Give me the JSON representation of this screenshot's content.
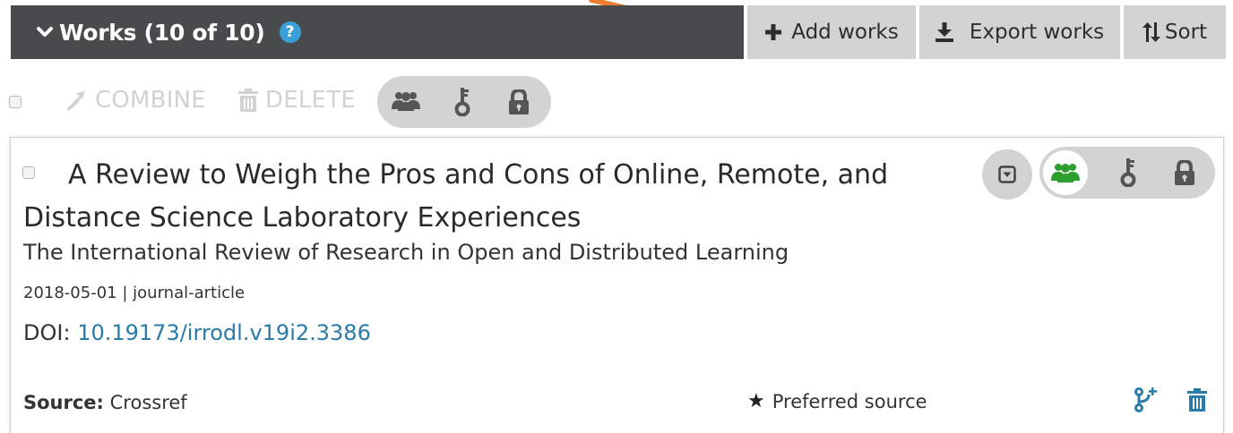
{
  "header": {
    "title": "Works (10 of 10)",
    "help_label": "?",
    "add_works_label": "Add works",
    "export_works_label": "Export works",
    "sort_label": "Sort"
  },
  "bulk_toolbar": {
    "combine_label": "COMBINE",
    "delete_label": "DELETE",
    "visibility_options": [
      "everyone-icon",
      "trusted-parties-icon",
      "only-me-icon"
    ]
  },
  "work": {
    "title": "A Review to Weigh the Pros and Cons of Online, Remote, and Distance Science Laboratory Experiences",
    "journal": "The International Review of Research in Open and Distributed Learning",
    "date": "2018-05-01",
    "separator": "|",
    "type": "journal-article",
    "doi_label": "DOI:",
    "doi": "10.19173/irrodl.v19i2.3386",
    "source_label": "Source:",
    "source": "Crossref",
    "preferred_label": "Preferred source",
    "visibility_selected": "everyone"
  },
  "colors": {
    "header_bg": "#484b4c",
    "button_bg": "#d3d3d3",
    "help_blue": "#3aa0d8",
    "link": "#2a7ba8",
    "public_green": "#2e9e2e",
    "accent_blue": "#2a7ba8",
    "arrow_orange": "#ee7d2d"
  }
}
